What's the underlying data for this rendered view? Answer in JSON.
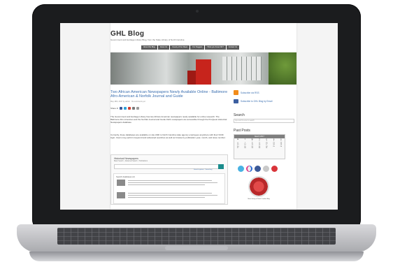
{
  "blog": {
    "title": "GHL Blog",
    "subtitle": "Government and Heritage Library Blog, from the State Library of North Carolina",
    "nav": [
      "About this Blog",
      "About Us",
      "County of the Week",
      "Our Nuggets",
      "Think you Know NC?",
      "Contact Us"
    ]
  },
  "post": {
    "title": "Two African American Newspapers Newly Available Online - Baltimore Afro-American & Norfolk Journal and Guide",
    "meta": "May 18th, 2017 by admin · No comments yet",
    "share_label": "Share it!",
    "para1": "The Government and Heritage Library has two African American newspapers newly available for online research. The Baltimore Afro-American and the Norfolk Journal and Guide 1921 newspapers are accessible through the ProQuest Historical Newspapers database.",
    "para2": "Currently, these databases are available on site AND to North Carolina state agency employees anywhere with their NCID login. Users may perform keyword and advanced searches as well as browse by publication year, month, and issue number.",
    "search_widget": {
      "title": "Historical Newspapers",
      "sub": "Basic Search · Advanced Search · Publications",
      "links": "Search options · Searching",
      "results_title": "Search databases (2)"
    }
  },
  "sidebar": {
    "rss_label": "Subscribe via RSS",
    "email_label": "Subscribe to GHL Blog by Email",
    "search_heading": "Search",
    "search_placeholder": "type and hit enter to search",
    "past_posts_heading": "Past Posts",
    "calendar_month": "March 2017",
    "calendar_days": [
      "M",
      "T",
      "W",
      "T",
      "F",
      "S",
      "S"
    ],
    "calendar_dates": [
      "",
      "",
      "1",
      "2",
      "3",
      "4",
      "5",
      "6",
      "7",
      "8",
      "9",
      "10",
      "11",
      "12",
      "13",
      "14",
      "15",
      "16",
      "17",
      "18",
      "19",
      "20",
      "21",
      "22",
      "23",
      "24",
      "25",
      "26",
      "27",
      "28",
      "29",
      "30",
      "31",
      "",
      ""
    ],
    "badge_text": "State Library of North Carolina Blog"
  },
  "social_icons": [
    "twitter-icon",
    "flickr-icon",
    "facebook-icon",
    "youtube-icon",
    "rss-icon"
  ]
}
